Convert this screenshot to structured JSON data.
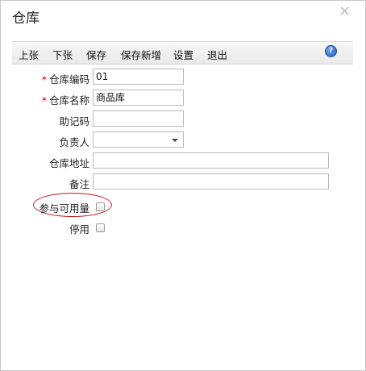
{
  "dialog": {
    "title": "仓库",
    "close_glyph": "×"
  },
  "toolbar": {
    "prev_label": "上张",
    "next_label": "下张",
    "save_label": "保存",
    "save_new_label": "保存新增",
    "settings_label": "设置",
    "exit_label": "退出",
    "help_icon": "help-icon",
    "help_glyph": "?"
  },
  "form": {
    "required_mark": "*",
    "code": {
      "label": "仓库编码",
      "value": "01"
    },
    "name": {
      "label": "仓库名称",
      "value": "商品库"
    },
    "mnemonic": {
      "label": "助记码",
      "value": ""
    },
    "owner": {
      "label": "负责人",
      "value": ""
    },
    "address": {
      "label": "仓库地址",
      "value": ""
    },
    "remark": {
      "label": "备注",
      "value": ""
    },
    "available_qty": {
      "label": "参与可用量",
      "checked": false
    },
    "disabled": {
      "label": "停用",
      "checked": false
    }
  },
  "colors": {
    "required": "#cc0000",
    "highlight": "#d01818",
    "help_icon": "#1f5fbf"
  }
}
